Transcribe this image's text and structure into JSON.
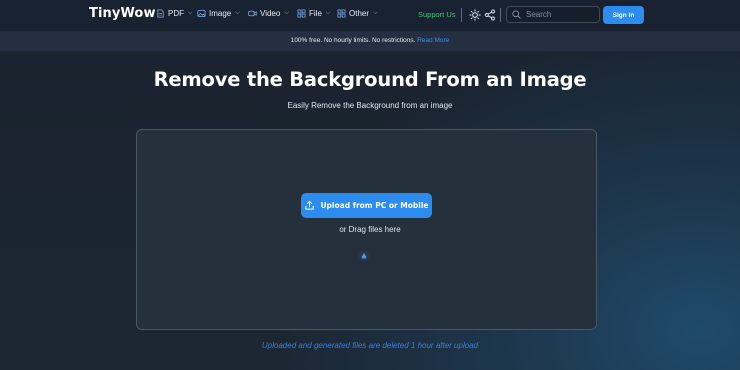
{
  "header": {
    "logo": "TinyWow",
    "nav": [
      {
        "label": "PDF",
        "icon": "pdf-icon"
      },
      {
        "label": "Image",
        "icon": "image-icon"
      },
      {
        "label": "Video",
        "icon": "video-icon"
      },
      {
        "label": "File",
        "icon": "file-icon"
      },
      {
        "label": "Other",
        "icon": "grid-icon"
      }
    ],
    "support_label": "Support Us",
    "search_placeholder": "Search",
    "signin_label": "Sign In"
  },
  "banner": {
    "text": "100% free. No hourly limits. No restrictions. ",
    "link": "Read More"
  },
  "main": {
    "title": "Remove the Background From an Image",
    "subtitle": "Easily Remove the Background from an image",
    "upload_label": "Upload from PC or Mobile",
    "drag_label": "or Drag files here",
    "footnote": "Uploaded and generated files are deleted 1 hour after upload"
  },
  "colors": {
    "accent": "#2d8cf0",
    "support": "#45c47a",
    "link": "#3f8ff0"
  }
}
